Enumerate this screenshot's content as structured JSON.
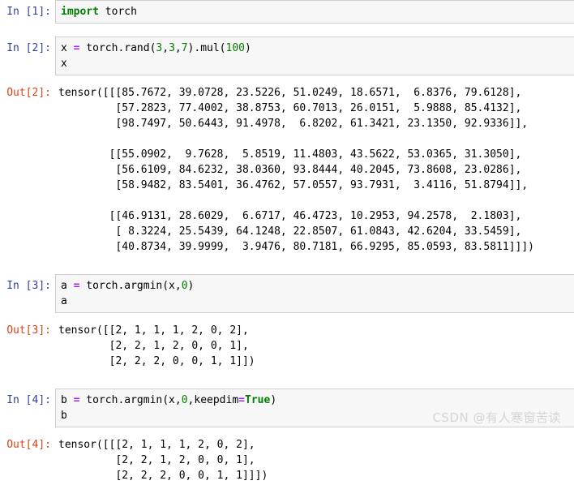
{
  "notebook": {
    "watermark": "CSDN @有人寒窗苦读",
    "colors": {
      "in_prompt": "#303f9f",
      "out_prompt": "#d84315",
      "input_background": "#f7f7f7",
      "input_border": "#cfcfcf",
      "keyword": "#008000",
      "number": "#008000",
      "operator": "#aa22ff",
      "text": "#000000",
      "page_background": "#ffffff"
    },
    "cells": [
      {
        "in_prompt": "In [1]:",
        "code": [
          {
            "tokens": [
              {
                "t": "import",
                "k": "kw"
              },
              {
                "t": " torch",
                "k": "plain"
              }
            ]
          }
        ],
        "out_prompt": null,
        "output": []
      },
      {
        "in_prompt": "In [2]:",
        "code": [
          {
            "tokens": [
              {
                "t": "x ",
                "k": "plain"
              },
              {
                "t": "=",
                "k": "op"
              },
              {
                "t": " torch.rand(",
                "k": "plain"
              },
              {
                "t": "3",
                "k": "num"
              },
              {
                "t": ",",
                "k": "plain"
              },
              {
                "t": "3",
                "k": "num"
              },
              {
                "t": ",",
                "k": "plain"
              },
              {
                "t": "7",
                "k": "num"
              },
              {
                "t": ").mul(",
                "k": "plain"
              },
              {
                "t": "100",
                "k": "num"
              },
              {
                "t": ")",
                "k": "plain"
              }
            ]
          },
          {
            "tokens": [
              {
                "t": "x",
                "k": "plain"
              }
            ]
          }
        ],
        "out_prompt": "Out[2]:",
        "output": [
          "tensor([[[85.7672, 39.0728, 23.5226, 51.0249, 18.6571,  6.8376, 79.6128],",
          "         [57.2823, 77.4002, 38.8753, 60.7013, 26.0151,  5.9888, 85.4132],",
          "         [98.7497, 50.6443, 91.4978,  6.8202, 61.3421, 23.1350, 92.9336]],",
          "",
          "        [[55.0902,  9.7628,  5.8519, 11.4803, 43.5622, 53.0365, 31.3050],",
          "         [56.6109, 84.6232, 38.0360, 93.8444, 40.2045, 73.8608, 23.0286],",
          "         [58.9482, 83.5401, 36.4762, 57.0557, 93.7931,  3.4116, 51.8794]],",
          "",
          "        [[46.9131, 28.6029,  6.6717, 46.4723, 10.2953, 94.2578,  2.1803],",
          "         [ 8.3224, 25.5439, 64.1248, 22.8507, 61.0843, 42.6204, 33.5459],",
          "         [40.8734, 39.9999,  3.9476, 80.7181, 66.9295, 85.0593, 83.5811]]])"
        ]
      },
      {
        "in_prompt": "In [3]:",
        "code": [
          {
            "tokens": [
              {
                "t": "a ",
                "k": "plain"
              },
              {
                "t": "=",
                "k": "op"
              },
              {
                "t": " torch.argmin(x,",
                "k": "plain"
              },
              {
                "t": "0",
                "k": "num"
              },
              {
                "t": ")",
                "k": "plain"
              }
            ]
          },
          {
            "tokens": [
              {
                "t": "a",
                "k": "plain"
              }
            ]
          }
        ],
        "out_prompt": "Out[3]:",
        "output": [
          "tensor([[2, 1, 1, 1, 2, 0, 2],",
          "        [2, 2, 1, 2, 0, 0, 1],",
          "        [2, 2, 2, 0, 0, 1, 1]])"
        ]
      },
      {
        "in_prompt": "In [4]:",
        "code": [
          {
            "tokens": [
              {
                "t": "b ",
                "k": "plain"
              },
              {
                "t": "=",
                "k": "op"
              },
              {
                "t": " torch.argmin(x,",
                "k": "plain"
              },
              {
                "t": "0",
                "k": "num"
              },
              {
                "t": ",keepdim",
                "k": "plain"
              },
              {
                "t": "=",
                "k": "op"
              },
              {
                "t": "True",
                "k": "bool"
              },
              {
                "t": ")",
                "k": "plain"
              }
            ]
          },
          {
            "tokens": [
              {
                "t": "b",
                "k": "plain"
              }
            ]
          }
        ],
        "out_prompt": "Out[4]:",
        "output": [
          "tensor([[[2, 1, 1, 1, 2, 0, 2],",
          "         [2, 2, 1, 2, 0, 0, 1],",
          "         [2, 2, 2, 0, 0, 1, 1]]])"
        ]
      }
    ]
  }
}
